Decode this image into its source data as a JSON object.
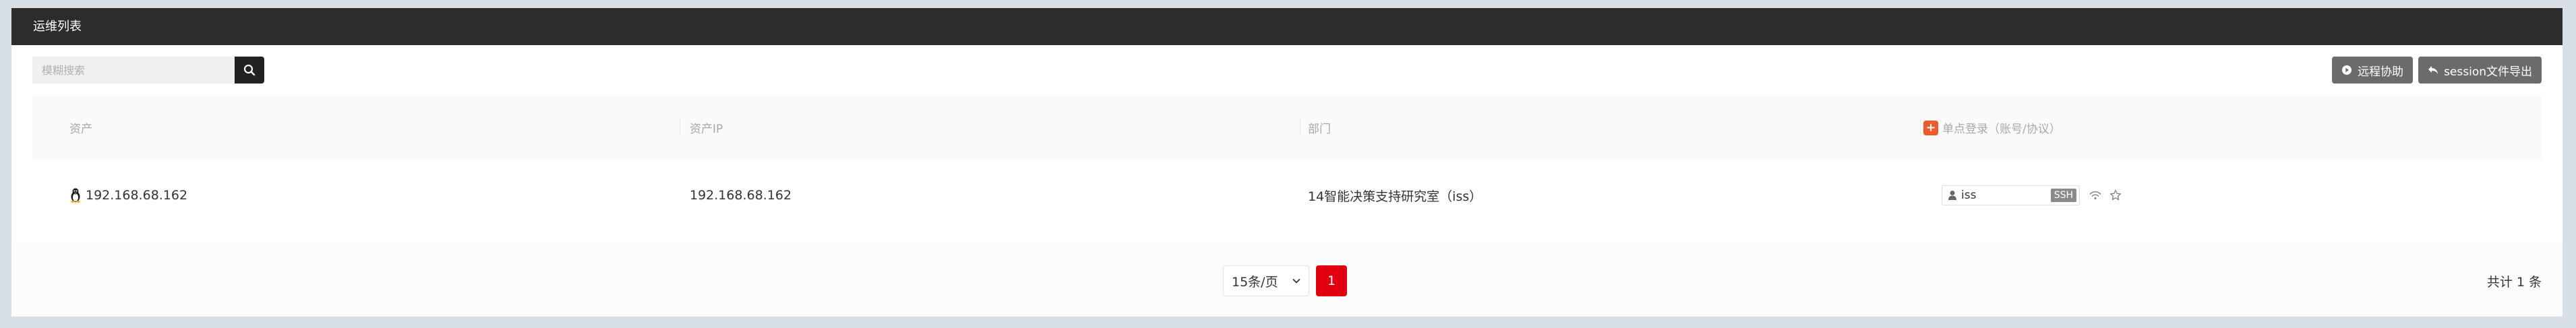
{
  "header": {
    "title": "运维列表"
  },
  "toolbar": {
    "search_placeholder": "模糊搜索",
    "remote_assist_label": "远程协助",
    "session_export_label": "session文件导出"
  },
  "table": {
    "columns": {
      "asset": "资产",
      "asset_ip": "资产IP",
      "department": "部门",
      "sso": "单点登录（账号/协议）"
    },
    "rows": [
      {
        "asset": "192.168.68.162",
        "asset_ip": "192.168.68.162",
        "department": "14智能决策支持研究室（iss）",
        "account": "iss",
        "protocol": "SSH"
      }
    ]
  },
  "pagination": {
    "page_size": "15条/页",
    "current_page": "1",
    "total_text": "共计 1 条"
  },
  "colors": {
    "header_bg": "#2c2c2c",
    "accent_red": "#e00010",
    "sso_orange": "#f05a28",
    "button_gray": "#6b6b6b"
  }
}
